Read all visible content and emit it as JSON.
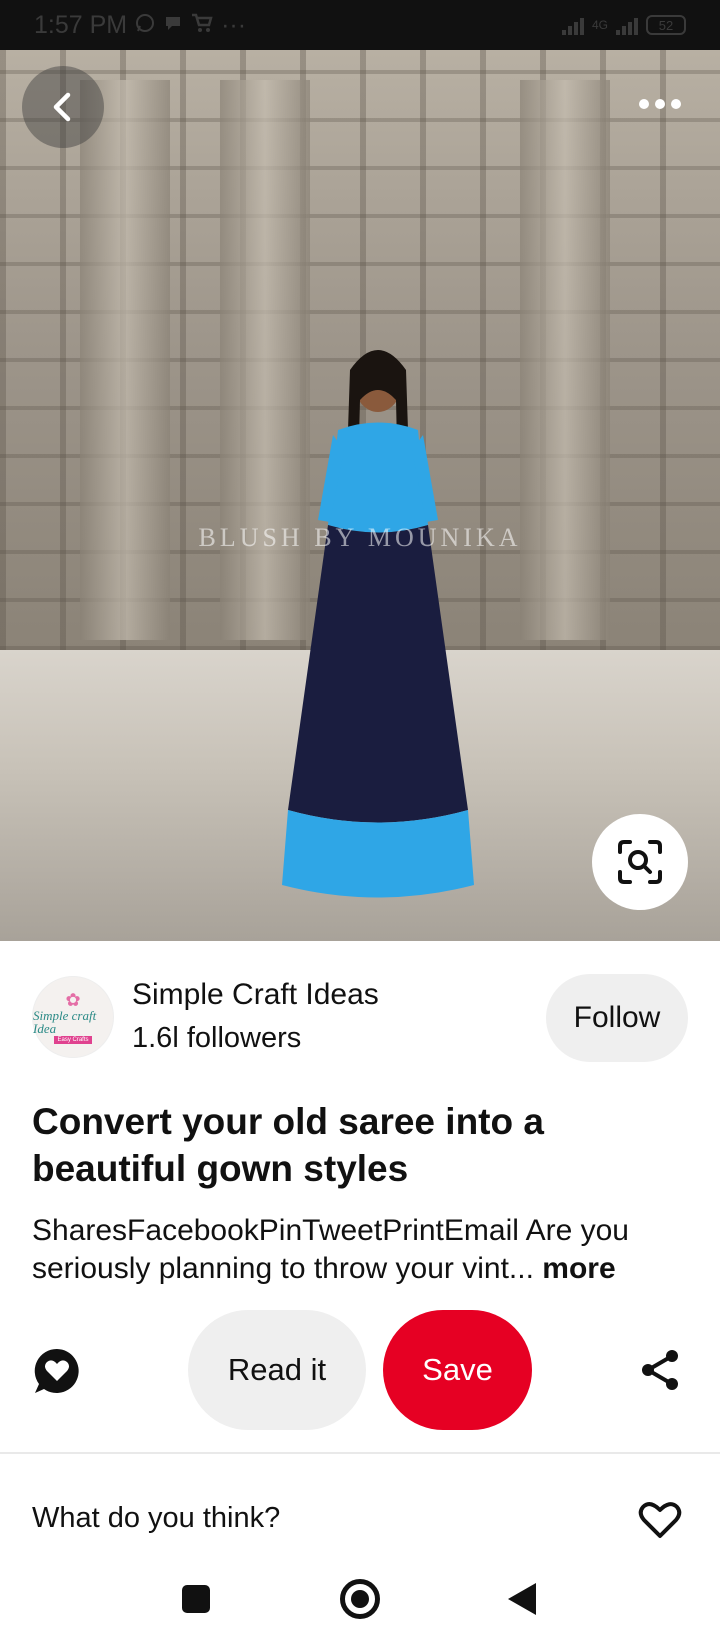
{
  "status_bar": {
    "time": "1:57 PM",
    "overflow": "···",
    "network": "4G",
    "battery": "52",
    "icons": [
      "whatsapp-icon",
      "chat-icon",
      "cart-icon",
      "signal-icon",
      "battery-icon"
    ]
  },
  "hero": {
    "watermark": "BLUSH BY MOUNIKA",
    "icons": [
      "back-arrow-icon",
      "more-dots-icon",
      "visual-search-icon"
    ]
  },
  "creator": {
    "name": "Simple Craft Ideas",
    "followers": "1.6l followers",
    "follow_label": "Follow",
    "avatar_text": "Simple craft Idea",
    "avatar_tag": "Easy Crafts"
  },
  "pin": {
    "title": "Convert your old saree into a beautiful gown styles",
    "description": "SharesFacebookPinTweetPrintEmail Are you seriously planning to throw your vint...",
    "more_label": "more"
  },
  "actions": {
    "read_label": "Read it",
    "save_label": "Save",
    "icons": [
      "comment-heart-icon",
      "share-icon"
    ]
  },
  "comments": {
    "prompt": "What do you think?",
    "icons": [
      "heart-outline-icon"
    ]
  },
  "colors": {
    "save_red": "#e60023",
    "pill_gray": "#efefef",
    "text": "#111111",
    "status_bar": "#111111"
  }
}
